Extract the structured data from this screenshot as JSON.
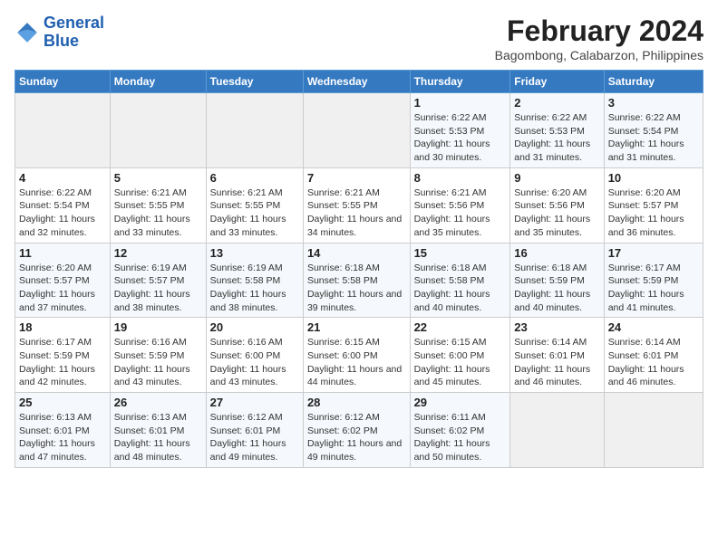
{
  "app": {
    "name_line1": "General",
    "name_line2": "Blue"
  },
  "title": "February 2024",
  "subtitle": "Bagombong, Calabarzon, Philippines",
  "days_of_week": [
    "Sunday",
    "Monday",
    "Tuesday",
    "Wednesday",
    "Thursday",
    "Friday",
    "Saturday"
  ],
  "weeks": [
    [
      {
        "num": "",
        "info": ""
      },
      {
        "num": "",
        "info": ""
      },
      {
        "num": "",
        "info": ""
      },
      {
        "num": "",
        "info": ""
      },
      {
        "num": "1",
        "info": "Sunrise: 6:22 AM\nSunset: 5:53 PM\nDaylight: 11 hours and 30 minutes."
      },
      {
        "num": "2",
        "info": "Sunrise: 6:22 AM\nSunset: 5:53 PM\nDaylight: 11 hours and 31 minutes."
      },
      {
        "num": "3",
        "info": "Sunrise: 6:22 AM\nSunset: 5:54 PM\nDaylight: 11 hours and 31 minutes."
      }
    ],
    [
      {
        "num": "4",
        "info": "Sunrise: 6:22 AM\nSunset: 5:54 PM\nDaylight: 11 hours and 32 minutes."
      },
      {
        "num": "5",
        "info": "Sunrise: 6:21 AM\nSunset: 5:55 PM\nDaylight: 11 hours and 33 minutes."
      },
      {
        "num": "6",
        "info": "Sunrise: 6:21 AM\nSunset: 5:55 PM\nDaylight: 11 hours and 33 minutes."
      },
      {
        "num": "7",
        "info": "Sunrise: 6:21 AM\nSunset: 5:55 PM\nDaylight: 11 hours and 34 minutes."
      },
      {
        "num": "8",
        "info": "Sunrise: 6:21 AM\nSunset: 5:56 PM\nDaylight: 11 hours and 35 minutes."
      },
      {
        "num": "9",
        "info": "Sunrise: 6:20 AM\nSunset: 5:56 PM\nDaylight: 11 hours and 35 minutes."
      },
      {
        "num": "10",
        "info": "Sunrise: 6:20 AM\nSunset: 5:57 PM\nDaylight: 11 hours and 36 minutes."
      }
    ],
    [
      {
        "num": "11",
        "info": "Sunrise: 6:20 AM\nSunset: 5:57 PM\nDaylight: 11 hours and 37 minutes."
      },
      {
        "num": "12",
        "info": "Sunrise: 6:19 AM\nSunset: 5:57 PM\nDaylight: 11 hours and 38 minutes."
      },
      {
        "num": "13",
        "info": "Sunrise: 6:19 AM\nSunset: 5:58 PM\nDaylight: 11 hours and 38 minutes."
      },
      {
        "num": "14",
        "info": "Sunrise: 6:18 AM\nSunset: 5:58 PM\nDaylight: 11 hours and 39 minutes."
      },
      {
        "num": "15",
        "info": "Sunrise: 6:18 AM\nSunset: 5:58 PM\nDaylight: 11 hours and 40 minutes."
      },
      {
        "num": "16",
        "info": "Sunrise: 6:18 AM\nSunset: 5:59 PM\nDaylight: 11 hours and 40 minutes."
      },
      {
        "num": "17",
        "info": "Sunrise: 6:17 AM\nSunset: 5:59 PM\nDaylight: 11 hours and 41 minutes."
      }
    ],
    [
      {
        "num": "18",
        "info": "Sunrise: 6:17 AM\nSunset: 5:59 PM\nDaylight: 11 hours and 42 minutes."
      },
      {
        "num": "19",
        "info": "Sunrise: 6:16 AM\nSunset: 5:59 PM\nDaylight: 11 hours and 43 minutes."
      },
      {
        "num": "20",
        "info": "Sunrise: 6:16 AM\nSunset: 6:00 PM\nDaylight: 11 hours and 43 minutes."
      },
      {
        "num": "21",
        "info": "Sunrise: 6:15 AM\nSunset: 6:00 PM\nDaylight: 11 hours and 44 minutes."
      },
      {
        "num": "22",
        "info": "Sunrise: 6:15 AM\nSunset: 6:00 PM\nDaylight: 11 hours and 45 minutes."
      },
      {
        "num": "23",
        "info": "Sunrise: 6:14 AM\nSunset: 6:01 PM\nDaylight: 11 hours and 46 minutes."
      },
      {
        "num": "24",
        "info": "Sunrise: 6:14 AM\nSunset: 6:01 PM\nDaylight: 11 hours and 46 minutes."
      }
    ],
    [
      {
        "num": "25",
        "info": "Sunrise: 6:13 AM\nSunset: 6:01 PM\nDaylight: 11 hours and 47 minutes."
      },
      {
        "num": "26",
        "info": "Sunrise: 6:13 AM\nSunset: 6:01 PM\nDaylight: 11 hours and 48 minutes."
      },
      {
        "num": "27",
        "info": "Sunrise: 6:12 AM\nSunset: 6:01 PM\nDaylight: 11 hours and 49 minutes."
      },
      {
        "num": "28",
        "info": "Sunrise: 6:12 AM\nSunset: 6:02 PM\nDaylight: 11 hours and 49 minutes."
      },
      {
        "num": "29",
        "info": "Sunrise: 6:11 AM\nSunset: 6:02 PM\nDaylight: 11 hours and 50 minutes."
      },
      {
        "num": "",
        "info": ""
      },
      {
        "num": "",
        "info": ""
      }
    ]
  ]
}
